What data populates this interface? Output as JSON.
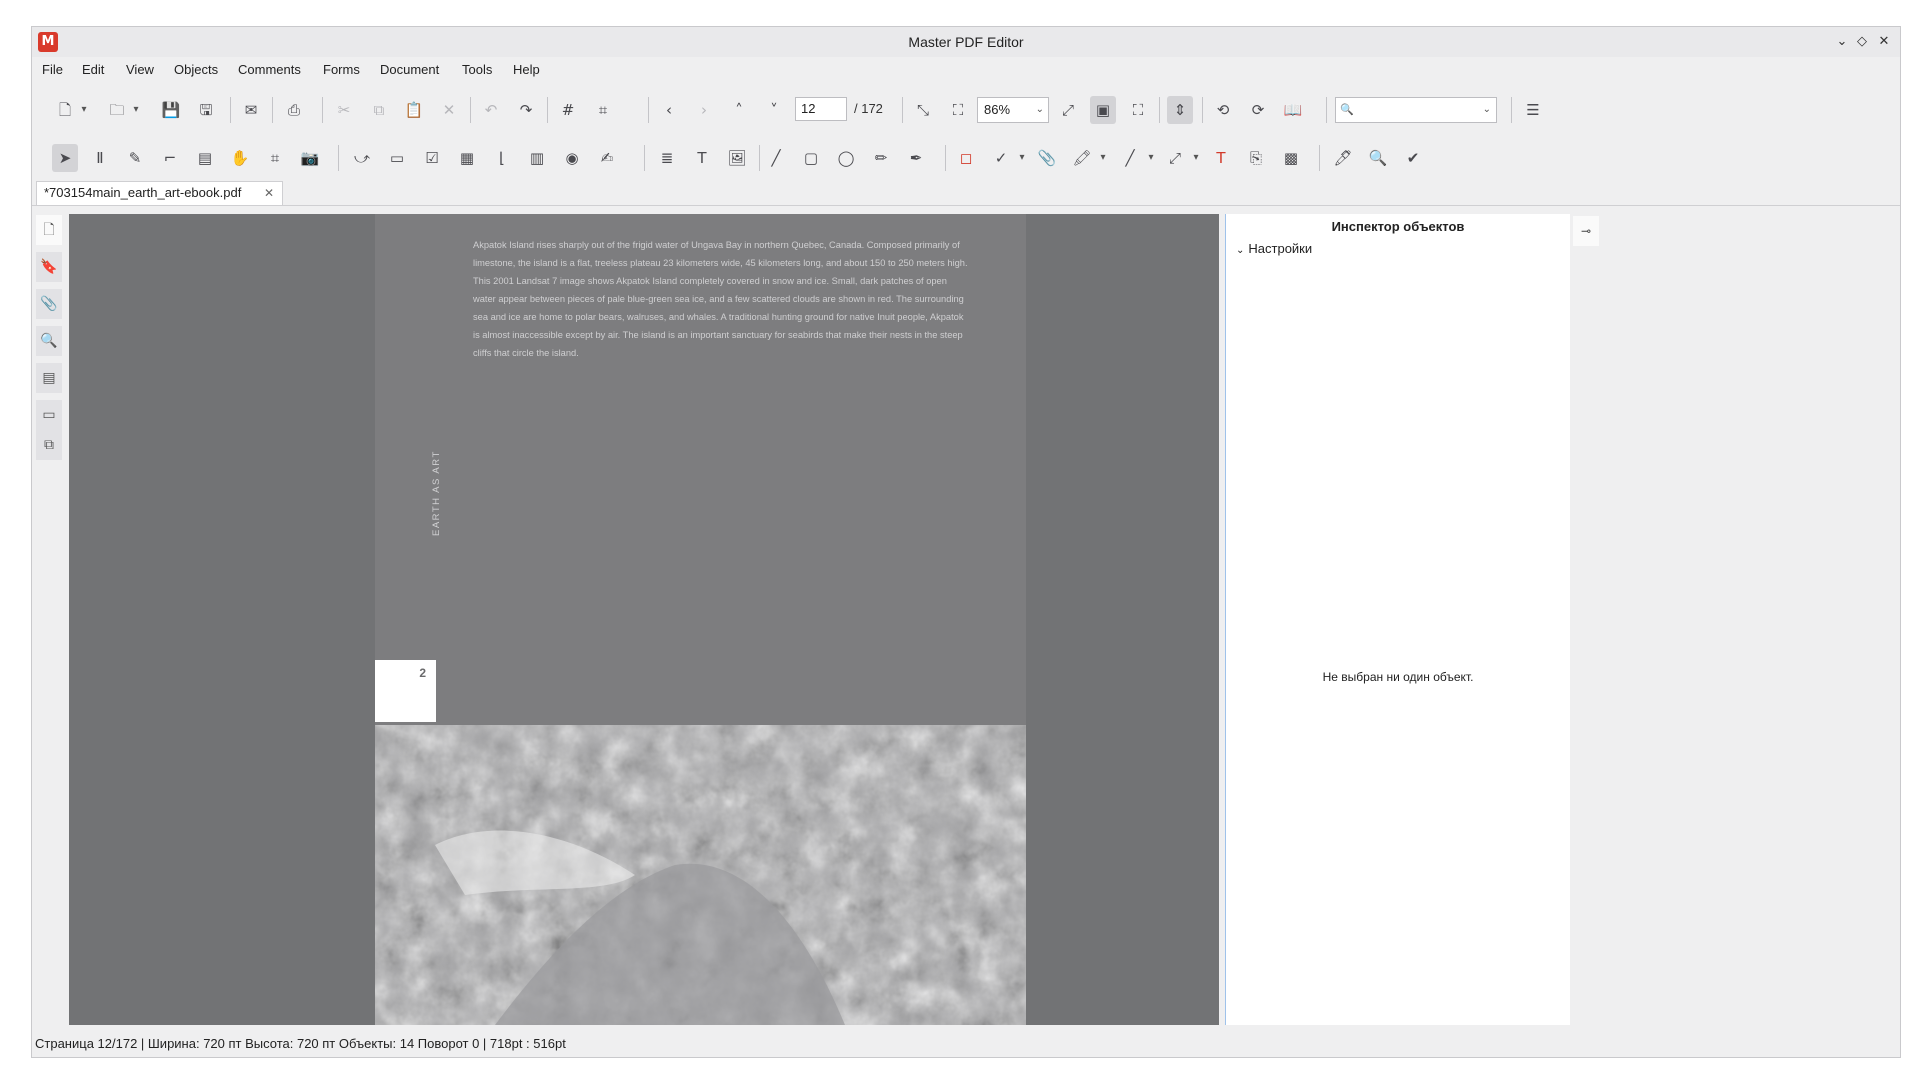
{
  "window": {
    "title": "Master PDF Editor",
    "logo_letter": "M"
  },
  "menu": [
    "File",
    "Edit",
    "View",
    "Objects",
    "Comments",
    "Forms",
    "Document",
    "Tools",
    "Help"
  ],
  "navigation": {
    "current_page": "12",
    "total_pages": "/ 172",
    "zoom": "86%"
  },
  "search": {
    "placeholder": ""
  },
  "tab": {
    "label": "*703154main_earth_art-ebook.pdf"
  },
  "document": {
    "paragraph": "Akpatok Island rises sharply out of the frigid water of Ungava Bay in northern Quebec, Canada. Composed primarily of limestone, the island is a flat, treeless plateau 23 kilometers wide, 45 kilometers long, and about 150 to 250 meters high. This 2001 Landsat 7 image shows Akpatok Island completely covered in snow and ice. Small, dark patches of open water appear between pieces of pale blue-green sea ice, and a few scattered clouds are shown in red. The surrounding sea and ice are home to polar bears, walruses, and whales. A traditional hunting ground for native Inuit people, Akpatok is almost inaccessible except by air. The island is an important sanctuary for seabirds that make their nests in the steep cliffs that circle the island.",
    "vertical_caption": "EARTH AS ART",
    "page_number": "2"
  },
  "inspector": {
    "title": "Инспектор объектов",
    "section": "Настройки",
    "empty_message": "Не выбран ни один объект."
  },
  "statusbar": {
    "text": "Страница 12/172 | Ширина: 720 пт Высота: 720 пт Объекты: 14 Поворот 0   |   718pt : 516pt"
  }
}
